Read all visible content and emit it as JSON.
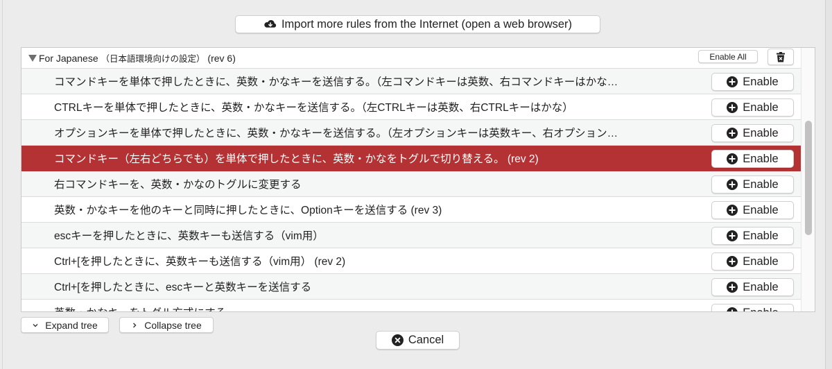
{
  "toolbar": {
    "import_label": "Import more rules from the Internet (open a web browser)",
    "import_icon": "cloud-download-icon"
  },
  "group": {
    "title": "For Japanese",
    "subtitle": "（日本語環境向けの設定）",
    "rev": "(rev 6)",
    "expanded": true,
    "enable_all_label": "Enable All",
    "delete_icon": "trash-icon"
  },
  "rules": [
    {
      "text": "コマンドキーを単体で押したときに、英数・かなキーを送信する。（左コマンドキーは英数、右コマンドキーはかな…",
      "button": "Enable",
      "style": "alt"
    },
    {
      "text": "CTRLキーを単体で押したときに、英数・かなキーを送信する。（左CTRLキーは英数、右CTRLキーはかな）",
      "button": "Enable",
      "style": "white"
    },
    {
      "text": "オプションキーを単体で押したときに、英数・かなキーを送信する。（左オプションキーは英数キー、右オプション…",
      "button": "Enable",
      "style": "alt"
    },
    {
      "text": "コマンドキー（左右どちらでも）を単体で押したときに、英数・かなをトグルで切り替える。 (rev 2)",
      "button": "Enable",
      "style": "selected"
    },
    {
      "text": "右コマンドキーを、英数・かなのトグルに変更する",
      "button": "Enable",
      "style": "alt"
    },
    {
      "text": "英数・かなキーを他のキーと同時に押したときに、Optionキーを送信する (rev 3)",
      "button": "Enable",
      "style": "white"
    },
    {
      "text": "escキーを押したときに、英数キーも送信する（vim用）",
      "button": "Enable",
      "style": "alt"
    },
    {
      "text": "Ctrl+[を押したときに、英数キーも送信する（vim用） (rev 2)",
      "button": "Enable",
      "style": "white"
    },
    {
      "text": "Ctrl+[を押したときに、escキーと英数キーを送信する",
      "button": "Enable",
      "style": "alt"
    },
    {
      "text": "英数・かなキーをトグル方式にする",
      "button": "Enable",
      "style": "white"
    }
  ],
  "footer": {
    "expand_label": "Expand tree",
    "collapse_label": "Collapse tree",
    "cancel_label": "Cancel"
  },
  "colors": {
    "selected_row": "#b53234",
    "alt_row": "#f5f6f6",
    "background": "#ececec"
  }
}
